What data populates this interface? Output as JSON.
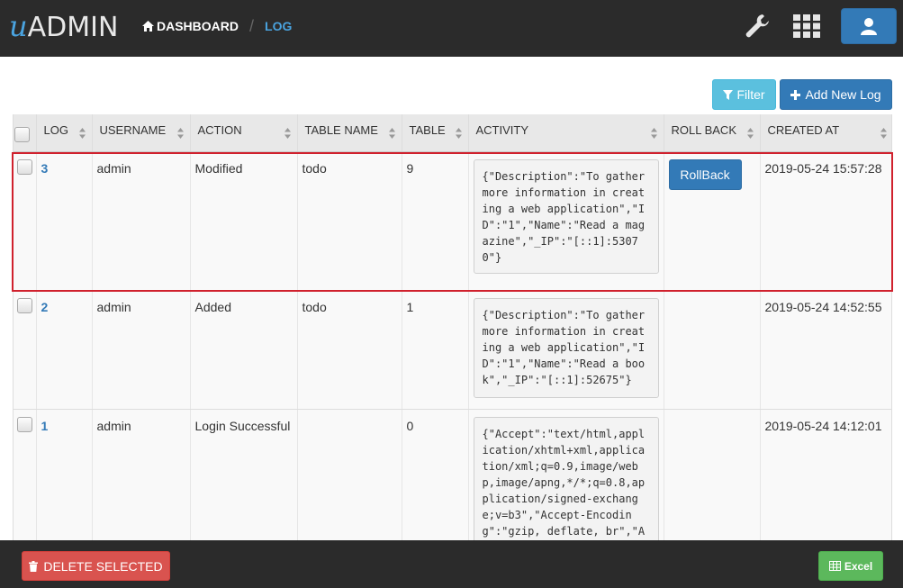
{
  "app": {
    "logo_u": "u",
    "logo_rest": "ADMIN"
  },
  "breadcrumb": {
    "home": "DASHBOARD",
    "separator": "/",
    "current": "LOG"
  },
  "toolbar": {
    "filter_label": "Filter",
    "add_label": "Add New Log"
  },
  "table": {
    "columns": [
      "LOG",
      "USERNAME",
      "ACTION",
      "TABLE NAME",
      "TABLE",
      "ACTIVITY",
      "ROLL BACK",
      "CREATED AT"
    ],
    "rows": [
      {
        "log": "3",
        "username": "admin",
        "action": "Modified",
        "table_name": "todo",
        "table": "9",
        "activity": "{\"Description\":\"To gather more information in creating a web application\",\"ID\":\"1\",\"Name\":\"Read a magazine\",\"_IP\":\"[::1]:53070\"}",
        "rollback": "RollBack",
        "created_at": "2019-05-24 15:57:28"
      },
      {
        "log": "2",
        "username": "admin",
        "action": "Added",
        "table_name": "todo",
        "table": "1",
        "activity": "{\"Description\":\"To gather more information in creating a web application\",\"ID\":\"1\",\"Name\":\"Read a book\",\"_IP\":\"[::1]:52675\"}",
        "rollback": "",
        "created_at": "2019-05-24 14:52:55"
      },
      {
        "log": "1",
        "username": "admin",
        "action": "Login Successful",
        "table_name": "",
        "table": "0",
        "activity": "{\"Accept\":\"text/html,application/xhtml+xml,application/xml;q=0.9,image/webp,image/apng,*/*;q=0.8,application/signed-exchange;v=b3\",\"Accept-Encoding\":\"gzip, deflate, br\",\"A",
        "rollback": "",
        "created_at": "2019-05-24 14:12:01"
      }
    ]
  },
  "footer": {
    "delete_label": "DELETE SELECTED",
    "excel_label": "Excel"
  },
  "colors": {
    "navbar": "#2b2b2b",
    "primary": "#337ab7",
    "info": "#5bc0de",
    "danger": "#d9534f",
    "success": "#5cb85c",
    "highlight": "#d0212d"
  },
  "icons": [
    "home-icon",
    "wrench-icon",
    "grid-icon",
    "user-icon",
    "filter-icon",
    "plus-icon",
    "trash-icon",
    "table-icon",
    "sort-icon"
  ]
}
